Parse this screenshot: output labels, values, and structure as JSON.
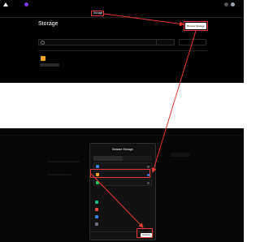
{
  "shot1": {
    "topbar": {
      "crumbs": [
        "",
        "",
        ""
      ],
      "actions": [
        "",
        "",
        ""
      ]
    },
    "nav": {
      "tabs": [
        "",
        "",
        "",
        "",
        "",
        "",
        "",
        "",
        "Storage",
        "",
        "",
        ""
      ],
      "active_index": 8
    },
    "page_title": "Storage",
    "description": "",
    "browse_button": "Browse Storage",
    "search_placeholder": "",
    "filter_label": "",
    "connect_label": "",
    "store": {
      "name": "",
      "meta": "",
      "chip": "",
      "right": ""
    }
  },
  "shot2": {
    "modal": {
      "title": "Browse Storage",
      "subtitle": "",
      "tabs": [
        "",
        ""
      ],
      "options": [
        {
          "name": "",
          "desc": "",
          "color": "#3b82f6",
          "selected": false
        },
        {
          "name": "",
          "desc": "",
          "color": "#f5a623",
          "selected": true
        },
        {
          "name": "",
          "desc": "",
          "color": "#22c55e",
          "selected": false
        }
      ],
      "section_label": "",
      "section_right": "",
      "integrations": [
        {
          "name": "",
          "desc": "",
          "color": "#10b981"
        },
        {
          "name": "",
          "desc": "",
          "color": "#ef4444"
        },
        {
          "name": "",
          "desc": "",
          "color": "#3b82f6"
        },
        {
          "name": "",
          "desc": "",
          "color": "#6b7280"
        }
      ],
      "cancel_label": "",
      "continue_label": "Continue"
    }
  },
  "colors": {
    "highlight": "#e53935",
    "store_accent": "#f5a623"
  }
}
